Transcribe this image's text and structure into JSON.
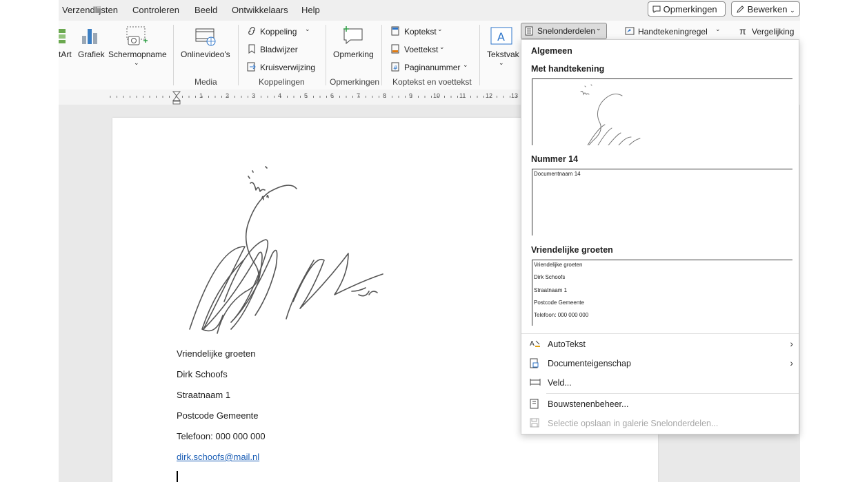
{
  "tabs": [
    "Verzendlijsten",
    "Controleren",
    "Beeld",
    "Ontwikkelaars",
    "Help"
  ],
  "header_buttons": {
    "comments": "Opmerkingen",
    "edit": "Bewerken"
  },
  "ribbon": {
    "smartart": "tArt",
    "chart": "Grafiek",
    "screenshot": "Schermopname",
    "online_video": "Onlinevideo's",
    "link": "Koppeling",
    "bookmark": "Bladwijzer",
    "cross_reference": "Kruisverwijzing",
    "comment": "Opmerking",
    "header": "Koptekst",
    "footer": "Voettekst",
    "page_number": "Paginanummer",
    "textbox": "Tekstvak",
    "quick_parts": "Snelonderdelen",
    "signature_line": "Handtekeningregel",
    "equation": "Vergelijking",
    "groups": {
      "media": "Media",
      "links": "Koppelingen",
      "comments": "Opmerkingen",
      "header_footer": "Koptekst en voettekst"
    }
  },
  "ruler": {
    "numbers": [
      "1",
      "2",
      "3",
      "4",
      "5",
      "6",
      "7",
      "8",
      "9",
      "10",
      "11",
      "12",
      "13"
    ]
  },
  "document": {
    "lines": [
      "Vriendelijke groeten",
      "Dirk Schoofs",
      "Straatnaam 1",
      "Postcode Gemeente",
      "Telefoon: 000 000 000"
    ],
    "email": "dirk.schoofs@mail.nl"
  },
  "dropdown": {
    "section": "Algemeen",
    "entries": [
      {
        "title": "Met handtekening",
        "preview": []
      },
      {
        "title": "Nummer 14",
        "preview": [
          "Documentnaam 14"
        ]
      },
      {
        "title": "Vriendelijke groeten",
        "preview": [
          "Vriendelijke groeten",
          "Dirk Schoofs",
          "Straatnaam 1",
          "Postcode Gemeente",
          "Telefoon: 000 000 000"
        ]
      }
    ],
    "menu": [
      {
        "label": "AutoTekst",
        "submenu": true,
        "disabled": false
      },
      {
        "label": "Documenteigenschap",
        "submenu": true,
        "disabled": false
      },
      {
        "label": "Veld...",
        "submenu": false,
        "disabled": false
      },
      {
        "label": "Bouwstenenbeheer...",
        "submenu": false,
        "disabled": false
      },
      {
        "label": "Selectie opslaan in galerie Snelonderdelen...",
        "submenu": false,
        "disabled": true
      }
    ]
  }
}
